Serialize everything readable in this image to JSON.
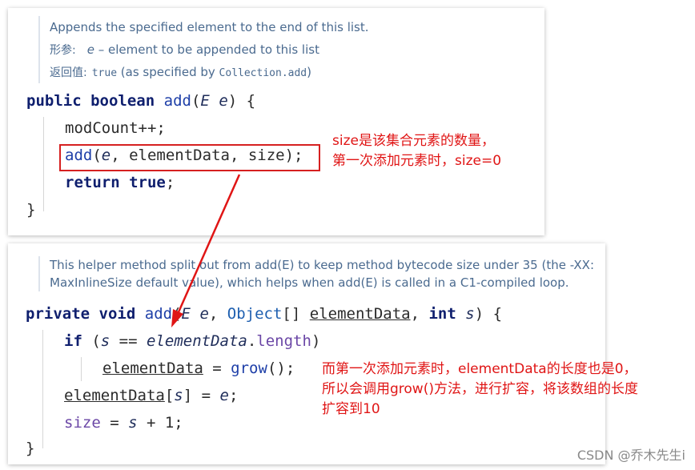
{
  "top_panel": {
    "doc": {
      "description": "Appends the specified element to the end of this list.",
      "param_label": "形参:",
      "param_name": "e",
      "param_desc": " – element to be appended to this list",
      "return_label": "返回值:",
      "return_code": "true",
      "return_text": " (as specified by ",
      "return_ref": "Collection.add",
      "return_close": ")"
    },
    "code": {
      "l1_kw1": "public",
      "l1_kw2": "boolean",
      "l1_method": "add",
      "l1_open": "(",
      "l1_type": "E",
      "l1_param": "e",
      "l1_close": ") {",
      "l2": "modCount++;",
      "l3_method": "add",
      "l3_open": "(",
      "l3_arg1": "e",
      "l3_rest": ", elementData, size);",
      "l4_kw": "return",
      "l4_val": "true",
      "l4_end": ";",
      "l5": "}"
    },
    "note_line1": "size是该集合元素的数量，",
    "note_line2": "第一次添加元素时，size=0"
  },
  "bottom_panel": {
    "doc": "This helper method split out from add(E) to keep method bytecode size under 35 (the -XX: MaxInlineSize default value), which helps when add(E) is called in a C1-compiled loop.",
    "code": {
      "l1_kw1": "private",
      "l1_kw2": "void",
      "l1_method": "add",
      "l1_open": "(",
      "l1_type": "E",
      "l1_p1": "e",
      "l1_sep1": ", ",
      "l1_cls": "Object",
      "l1_arr": "[] ",
      "l1_p2": "elementData",
      "l1_sep2": ", ",
      "l1_kw3": "int",
      "l1_p3": "s",
      "l1_close": ") {",
      "l2_kw": "if",
      "l2_open": " (",
      "l2_s": "s",
      "l2_eq": " == ",
      "l2_arr": "elementData",
      "l2_dot": ".",
      "l2_len": "length",
      "l2_close": ")",
      "l3_var": "elementData",
      "l3_eq": " = ",
      "l3_call": "grow",
      "l3_end": "();",
      "l4_var": "elementData",
      "l4_open": "[",
      "l4_s": "s",
      "l4_mid": "] = ",
      "l4_e": "e",
      "l4_end": ";",
      "l5_size": "size",
      "l5_eq": " = ",
      "l5_s": "s",
      "l5_rest": " + 1;",
      "l6": "}"
    },
    "note_line1": "而第一次添加元素时，elementData的长度也是0，",
    "note_line2": "所以会调用grow()方法，进行扩容，将该数组的长度",
    "note_line3": "扩容到10"
  },
  "watermark": "CSDN @乔木先生i",
  "colors": {
    "annotation": "#e01515",
    "keyword": "#0f1f6e",
    "method": "#1e3fa8",
    "field": "#6b47a6",
    "doc_text": "#4a6a8f"
  }
}
